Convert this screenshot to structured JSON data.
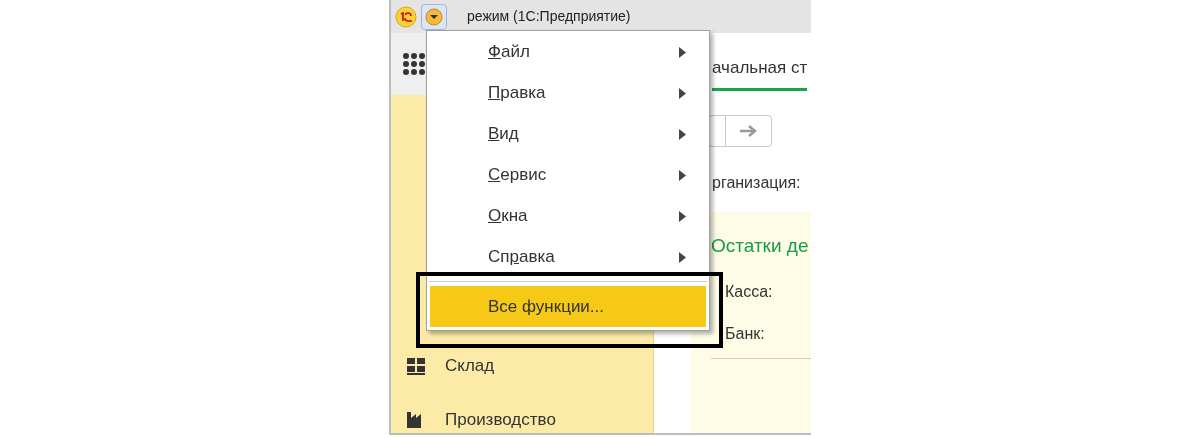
{
  "window": {
    "title": "режим  (1С:Предприятие)"
  },
  "tab": {
    "label": "ачальная ст",
    "selected": true
  },
  "sidebar": {
    "items": [
      {
        "label": "Склад",
        "kind": "warehouse"
      },
      {
        "label": "Производство",
        "kind": "production"
      }
    ]
  },
  "content": {
    "organization_label": "рганизация:",
    "panel_title": "Остатки де",
    "rows": [
      "Касса:",
      "Банк:"
    ]
  },
  "menu": {
    "items": [
      {
        "key": "Ф",
        "post": "айл",
        "has_submenu": true,
        "selected": false
      },
      {
        "key": "П",
        "post": "равка",
        "has_submenu": true,
        "selected": false
      },
      {
        "key": "В",
        "post": "ид",
        "has_submenu": true,
        "selected": false
      },
      {
        "key": "С",
        "post": "ервис",
        "has_submenu": true,
        "selected": false
      },
      {
        "key": "О",
        "post": "кна",
        "has_submenu": true,
        "selected": false
      },
      {
        "pre": "Сп",
        "key": "р",
        "post": "авка",
        "has_submenu": true,
        "selected": false
      },
      {
        "pre": "Все функции...",
        "has_submenu": false,
        "selected": true,
        "separator_before": true
      }
    ]
  }
}
